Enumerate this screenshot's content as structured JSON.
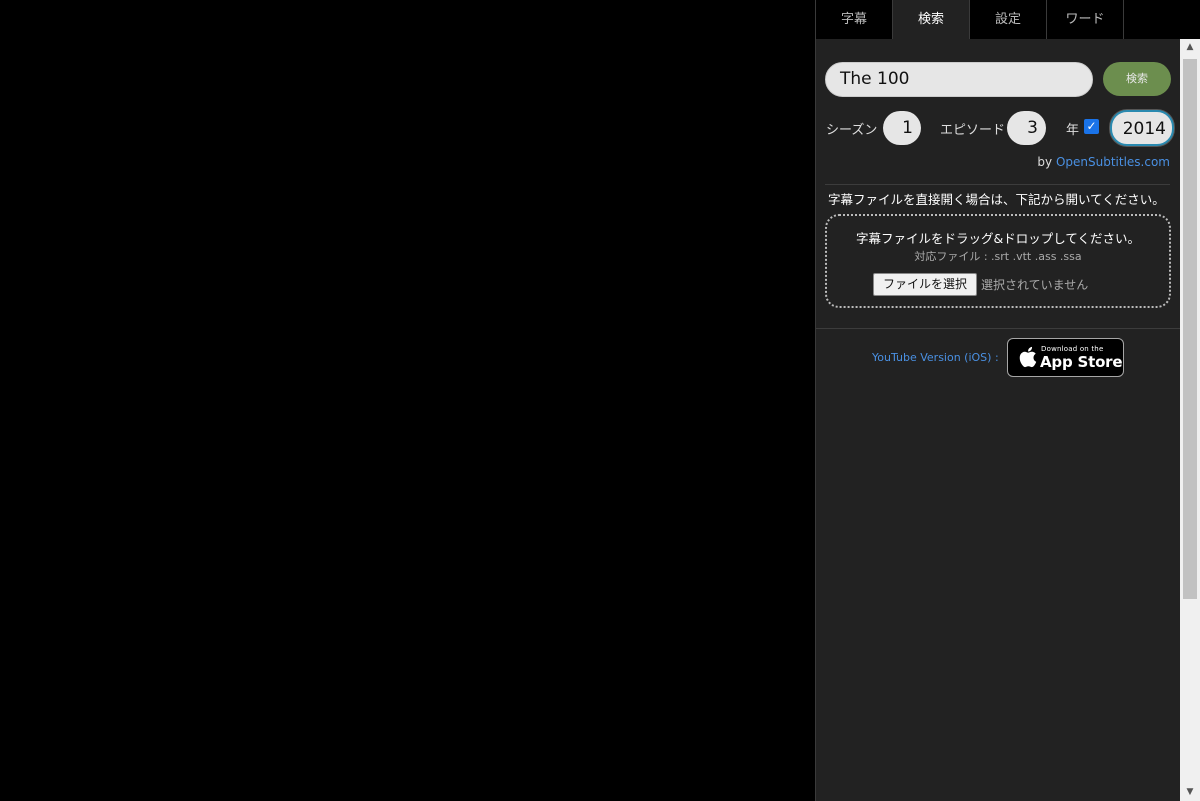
{
  "tabs": [
    {
      "label": "字幕"
    },
    {
      "label": "検索"
    },
    {
      "label": "設定"
    },
    {
      "label": "ワード"
    }
  ],
  "active_tab": "検索",
  "search": {
    "value": "The 100",
    "button_label": "検索"
  },
  "filters": {
    "season_label": "シーズン",
    "season_value": "1",
    "episode_label": "エピソード",
    "episode_value": "3",
    "year_label": "年",
    "year_checked": true,
    "year_value": "2014"
  },
  "credit": {
    "prefix": "by",
    "link": "OpenSubtitles.com"
  },
  "direct_open_note": "字幕ファイルを直接開く場合は、下記から開いてください。",
  "dropzone": {
    "title": "字幕ファイルをドラッグ&ドロップしてください。",
    "supported": "対応ファイル : .srt .vtt .ass .ssa",
    "file_button": "ファイルを選択",
    "file_status": "選択されていません"
  },
  "youtube": {
    "label": "YouTube Version (iOS) :",
    "badge_small": "Download on the",
    "badge_big": "App Store"
  },
  "colors": {
    "search_button": "#6c8e4e",
    "link": "#4a90e2",
    "checkbox": "#1a73e8"
  }
}
